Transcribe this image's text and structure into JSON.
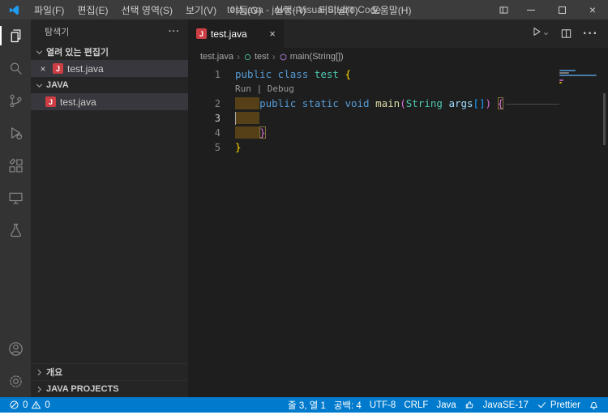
{
  "window": {
    "title": "test.java - java - Visual Studio Code",
    "menu": [
      {
        "label": "파일(F)"
      },
      {
        "label": "편집(E)"
      },
      {
        "label": "선택 영역(S)"
      },
      {
        "label": "보기(V)"
      },
      {
        "label": "이동(G)"
      },
      {
        "label": "실행(R)"
      },
      {
        "label": "터미널(T)"
      },
      {
        "label": "도움말(H)"
      }
    ]
  },
  "activity_bar": {
    "items": [
      {
        "name": "explorer",
        "active": true
      },
      {
        "name": "search"
      },
      {
        "name": "source-control"
      },
      {
        "name": "run-and-debug"
      },
      {
        "name": "extensions"
      },
      {
        "name": "remote-explorer"
      },
      {
        "name": "testing"
      }
    ],
    "bottom_items": [
      {
        "name": "accounts"
      },
      {
        "name": "manage"
      }
    ]
  },
  "sidebar": {
    "title": "탐색기",
    "sections": [
      {
        "label": "열려 있는 편집기",
        "items": [
          {
            "label": "test.java",
            "closable": true,
            "selected": true
          }
        ]
      },
      {
        "label": "JAVA",
        "items": [
          {
            "label": "test.java",
            "selected": true,
            "indent": true
          }
        ]
      }
    ],
    "collapsed_sections": [
      {
        "label": "개요"
      },
      {
        "label": "JAVA PROJECTS"
      }
    ]
  },
  "editor": {
    "tabs": [
      {
        "label": "test.java",
        "active": true
      }
    ],
    "breadcrumbs": [
      {
        "label": "test.java"
      },
      {
        "label": "test",
        "icon": "symbol-class"
      },
      {
        "label": "main(String[])",
        "icon": "symbol-method"
      }
    ],
    "code": {
      "token_styles": {
        "keyword": {
          "color": "#569CD6"
        },
        "type": {
          "color": "#4EC9B0"
        },
        "function": {
          "color": "#DCDCAA"
        },
        "param": {
          "color": "#9CDCFE"
        },
        "plain": {
          "color": "#D4D4D4"
        },
        "bracket1": {
          "color": "#FFD700"
        },
        "bracket2": {
          "color": "#DA70D6"
        },
        "bracket3": {
          "color": "#179FFF"
        },
        "codelens": {
          "color": "#999999"
        },
        "codelens-link": {
          "color": "#999999"
        },
        "indent-highlight": {
          "color": "#D4D4D4",
          "background": "#564018"
        },
        "matched": {
          "outline": "1px solid #806F3F"
        }
      },
      "lines": [
        {
          "number": 1,
          "tokens": [
            {
              "t": "public class ",
              "s": "keyword"
            },
            {
              "t": "test ",
              "s": "type"
            },
            {
              "t": "{",
              "s": "bracket1"
            }
          ]
        },
        {
          "codelens": true,
          "tokens": [
            {
              "t": "Run",
              "s": "codelens-link"
            },
            {
              "t": " | ",
              "s": "codelens"
            },
            {
              "t": "Debug",
              "s": "codelens-link"
            }
          ]
        },
        {
          "number": 2,
          "trail_line": true,
          "tokens": [
            {
              "t": "    ",
              "s": "indent-highlight"
            },
            {
              "t": "public static void ",
              "s": "keyword"
            },
            {
              "t": "main",
              "s": "function"
            },
            {
              "t": "(",
              "s": "bracket2"
            },
            {
              "t": "String",
              "s": "type"
            },
            {
              "t": " ",
              "s": "plain"
            },
            {
              "t": "args",
              "s": "param"
            },
            {
              "t": "[]",
              "s": "bracket3"
            },
            {
              "t": ")",
              "s": "bracket2"
            },
            {
              "t": " ",
              "s": "plain"
            },
            {
              "t": "{",
              "s": "bracket2 matched"
            }
          ]
        },
        {
          "number": 3,
          "active": true,
          "cursor": true,
          "tokens": [
            {
              "t": "    ",
              "s": "indent-highlight"
            }
          ]
        },
        {
          "number": 4,
          "tokens": [
            {
              "t": "    ",
              "s": "indent-highlight"
            },
            {
              "t": "}",
              "s": "bracket2 matched"
            }
          ]
        },
        {
          "number": 5,
          "tokens": [
            {
              "t": "}",
              "s": "bracket1"
            }
          ]
        }
      ]
    }
  },
  "status_bar": {
    "errors": "0",
    "warnings": "0",
    "cursor_position": "줄 3, 열 1",
    "indentation": "공백: 4",
    "encoding": "UTF-8",
    "eol": "CRLF",
    "language": "Java",
    "runtime": "JavaSE-17",
    "formatter": "Prettier"
  },
  "colors": {
    "status_bar_bg": "#007ACC",
    "title_bar_bg": "#3C3C3C",
    "activity_bar_bg": "#333333",
    "sidebar_bg": "#252526",
    "editor_bg": "#1E1E1E",
    "selected_row_bg": "#37373D",
    "indent_highlight_bg": "#564018",
    "java_file_icon": "#CC3E44",
    "symbol_class_icon": "#4EC9B0",
    "symbol_method_icon": "#B180D7"
  }
}
